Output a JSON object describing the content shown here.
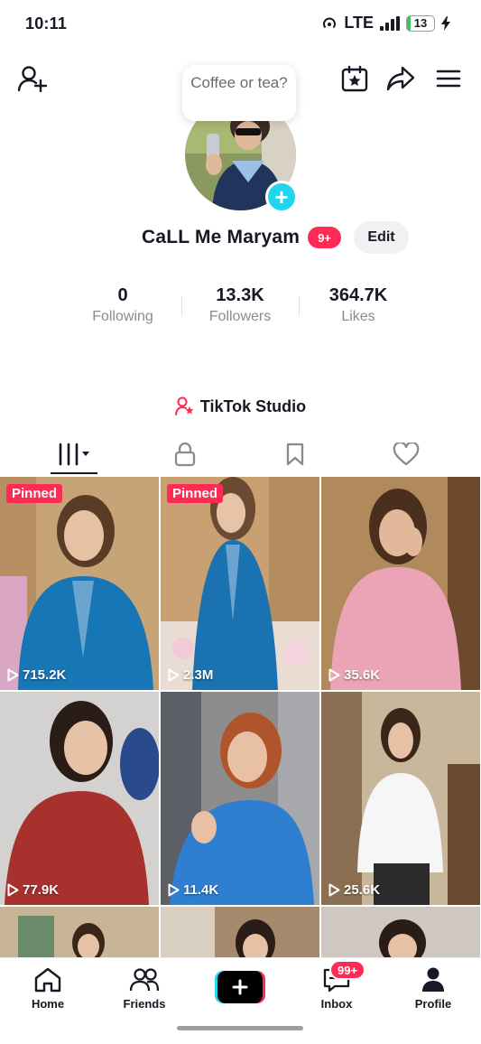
{
  "status_bar": {
    "time": "10:11",
    "network": "LTE",
    "battery": "13",
    "battery_level": 0.13
  },
  "top_bar": {
    "add_friend_icon": "person-plus-icon",
    "calendar_icon": "calendar-star-icon",
    "share_icon": "share-arrow-icon",
    "menu_icon": "hamburger-menu-icon"
  },
  "profile": {
    "note": "Coffee or tea?",
    "name": "CaLL Me Maryam",
    "notification_badge": "9+",
    "edit_label": "Edit"
  },
  "stats": [
    {
      "value": "0",
      "label": "Following"
    },
    {
      "value": "13.3K",
      "label": "Followers"
    },
    {
      "value": "364.7K",
      "label": "Likes"
    }
  ],
  "studio": {
    "label": "TikTok Studio"
  },
  "tabs": [
    "videos-grid-icon",
    "lock-icon",
    "bookmark-icon",
    "heart-icon"
  ],
  "videos": [
    {
      "pinned": "Pinned",
      "views": "715.2K"
    },
    {
      "pinned": "Pinned",
      "views": "2.3M"
    },
    {
      "views": "35.6K"
    },
    {
      "views": "77.9K"
    },
    {
      "views": "11.4K"
    },
    {
      "views": "25.6K"
    }
  ],
  "bottom_nav": {
    "home": "Home",
    "friends": "Friends",
    "inbox": "Inbox",
    "inbox_badge": "99+",
    "profile": "Profile"
  },
  "colors": {
    "accent": "#fe2c55",
    "cyan": "#20d5ec",
    "text": "#161823",
    "muted": "#8a8b91"
  }
}
